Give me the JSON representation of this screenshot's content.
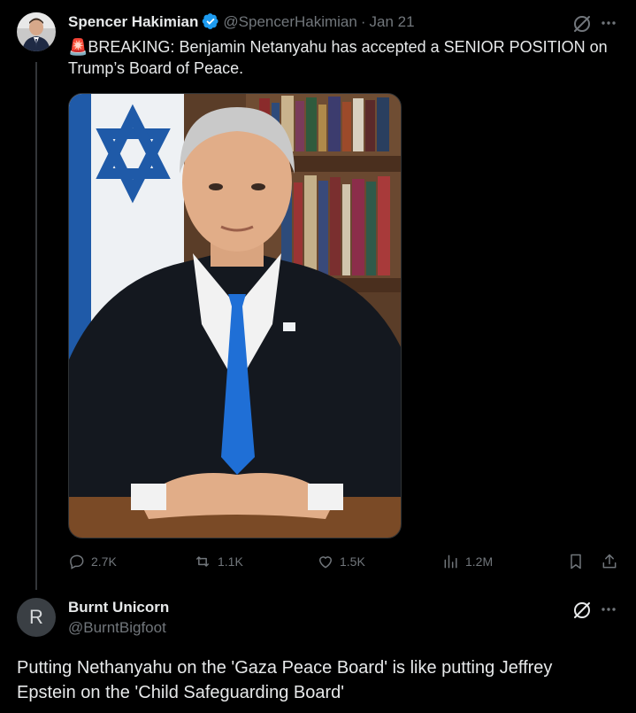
{
  "tweet": {
    "author_name": "Spencer Hakimian",
    "handle": "@SpencerHakimian",
    "separator": "·",
    "date": "Jan 21",
    "text_line1": "🚨BREAKING: Benjamin Netanyahu has accepted a SENIOR POSITION on",
    "text_line2": "Trump’s Board of Peace.",
    "actions": {
      "replies": "2.7K",
      "retweets": "1.1K",
      "likes": "1.5K",
      "views": "1.2M"
    }
  },
  "reply": {
    "avatar_letter": "R",
    "author_name": "Burnt Unicorn",
    "handle": "@BurntBigfoot",
    "text_line1": "Putting Nethanyahu on the 'Gaza Peace Board' is like putting Jeffrey",
    "text_line2": "Epstein on the 'Child Safeguarding Board'"
  },
  "colors": {
    "background": "#000000",
    "text": "#e7e9ea",
    "muted": "#71767b",
    "verified": "#1d9bf0",
    "divider": "#2f3336"
  },
  "icons": [
    "verified-badge-icon",
    "grok-icon",
    "more-icon",
    "reply-icon",
    "retweet-icon",
    "like-icon",
    "views-icon",
    "bookmark-icon",
    "share-icon"
  ]
}
